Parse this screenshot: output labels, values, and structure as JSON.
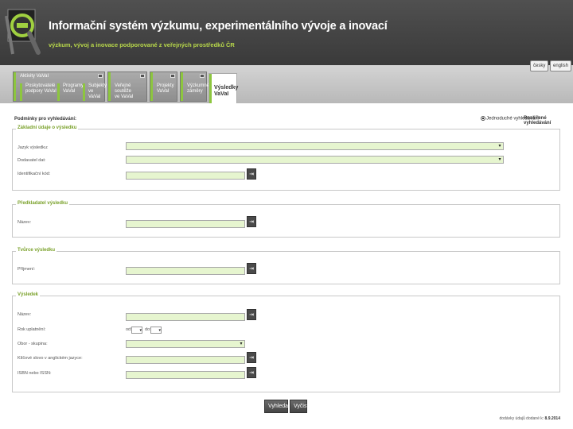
{
  "header": {
    "title": "Informační systém výzkumu, experimentálního vývoje a inovací",
    "subtitle": "výzkum, vývoj a inovace podporované z veřejných prostředků ČR",
    "lang_cz": "česky",
    "lang_en": "english"
  },
  "tabs": {
    "group1_title": "Aktivity VaVaI",
    "group1_sub1": [
      "Poskytovatelé",
      "podpory VaVaI"
    ],
    "group1_sub2": [
      "Programy",
      "VaVaI"
    ],
    "group1_sub3": [
      "Subjekty",
      "ve VaVaI"
    ],
    "tab_soutez": [
      "Veřejné soutěže",
      "ve VaVaI"
    ],
    "tab_projekty": [
      "Projekty",
      "VaVaI"
    ],
    "tab_zamery": [
      "Výzkumné",
      "záměry"
    ],
    "tab_vysledky": [
      "Výsledky",
      "VaVaI"
    ]
  },
  "search": {
    "conditions_label": "Podmínky pro vyhledávání:",
    "mode_simple": "Jednoduché vyhledávání",
    "mode_extended": "Rozšířené vyhledávání"
  },
  "sections": {
    "basic": {
      "legend": "Základní údaje o výsledku",
      "language_label": "Jazyk výsledku:",
      "delivery_label": "Dodavatel dat:",
      "id_label": "Identifikační kód:"
    },
    "provider": {
      "legend": "Předkladatel výsledku",
      "name_label": "Název:"
    },
    "author": {
      "legend": "Tvůrce výsledku",
      "surname_label": "Příjmení:"
    },
    "result": {
      "legend": "Výsledek",
      "name_label": "Název:",
      "year_label": "Rok uplatnění:",
      "from_label": "od:",
      "to_label": "do:",
      "field_label": "Obor - skupina:",
      "keywords_label": "Klíčové slovo v anglickém jazyce:",
      "isbn_label": "ISBN nebo ISSN:"
    }
  },
  "buttons": {
    "search": "Vyhledat",
    "clear": "Vyčistit"
  },
  "footer": {
    "text": "dodávky údajů dodané k:",
    "date": "8.9.2014"
  },
  "colors": {
    "accent_green": "#8dc63f",
    "input_bg": "#e6f5cf",
    "header_bg": "#3a3a3a"
  }
}
